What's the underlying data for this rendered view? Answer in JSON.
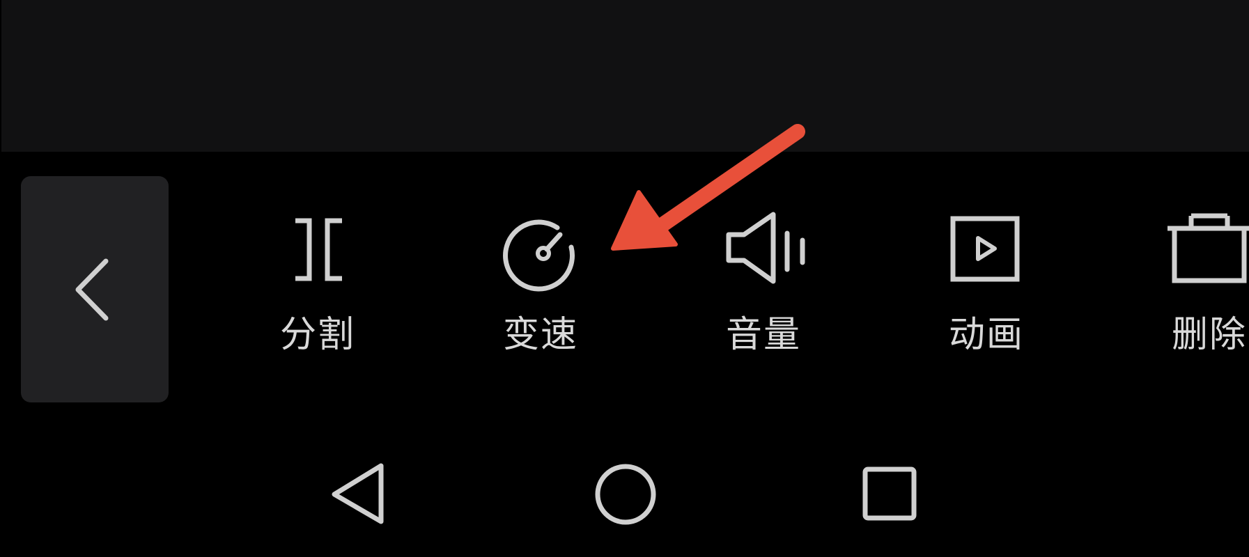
{
  "toolbar": {
    "back_icon": "chevron-left-icon",
    "tools": [
      {
        "id": "split",
        "label": "分割",
        "icon": "split-icon"
      },
      {
        "id": "speed",
        "label": "变速",
        "icon": "speedometer-icon"
      },
      {
        "id": "volume",
        "label": "音量",
        "icon": "volume-icon"
      },
      {
        "id": "animation",
        "label": "动画",
        "icon": "animation-play-icon"
      },
      {
        "id": "delete",
        "label": "删除",
        "icon": "trash-icon"
      }
    ]
  },
  "annotation": {
    "icon": "red-arrow-icon",
    "color": "#e8503a"
  },
  "navigation_bar": {
    "buttons": [
      {
        "id": "back",
        "icon": "triangle-back-icon"
      },
      {
        "id": "home",
        "icon": "circle-home-icon"
      },
      {
        "id": "recents",
        "icon": "square-recents-icon"
      }
    ]
  },
  "colors": {
    "background": "#000000",
    "top_panel": "#111112",
    "back_button_bg": "#212123",
    "icon_stroke": "#d0d0d0",
    "label_text": "#d9d9d9"
  }
}
